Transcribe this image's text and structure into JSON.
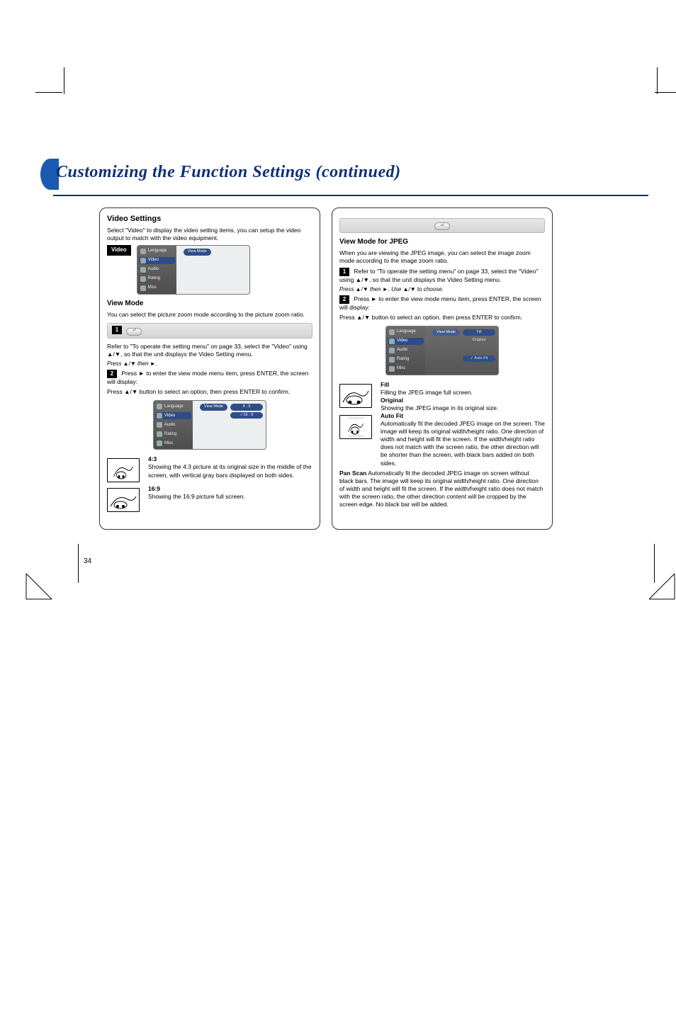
{
  "heading": "Customizing the Function Settings (continued)",
  "page_number": "34",
  "leftCol": {
    "title": "Video Settings",
    "desc": "Select \"Video\" to display the video setting items, you can setup the video output to match with the video equipment.",
    "badge": "Video",
    "viewModeTitle": "View Mode",
    "viewModeDesc": "You can select the picture zoom mode according to the picture zoom ratio.",
    "step1": "Refer to \"To operate the setting menu\" on page 33, select the \"Video\" using ▲/▼, so that the unit displays the Video Setting menu.",
    "step2a": "Press ► to enter the view mode menu item, press ENTER, the screen will display:",
    "step2b": "Press ▲/▼ button to select an option, then press ENTER to confirm.",
    "ratio43_title": "4:3",
    "ratio43_desc": "Showing the 4:3 picture at its original size in the middle of the screen, with vertical gray bars displayed on both sides.",
    "ratio169_title": "16:9",
    "ratio169_desc": "Showing the 16:9 picture full screen."
  },
  "rightCol": {
    "jpeg_title": "View Mode for JPEG",
    "jpeg_desc": "When you are viewing the JPEG image, you can select the image zoom mode according to the image zoom ratio.",
    "step1": "Refer to \"To operate the setting menu\" on page 33, select the \"Video\" using ▲/▼, so that the unit displays the Video Setting menu.",
    "step2a": "Press ► to enter the view mode menu item, press ENTER, the screen will display:",
    "step2b": "Press ▲/▼ button to select an option, then press ENTER to confirm.",
    "opt_fill": "Fill",
    "opt_fill_desc": "Filling the JPEG image full screen.",
    "opt_original": "Original",
    "opt_original_desc": "Showing the JPEG image in its original size.",
    "opt_autofit": "Auto Fit",
    "opt_autofit_desc": "Automatically fit the decoded JPEG image on the screen. The image will keep its original width/height ratio. One direction of width and height will fit the screen. If the width/height ratio does not match with the screen ratio, the other direction will be shorter than the screen, with black bars added on both sides.",
    "opt_panscan": "Pan Scan",
    "opt_panscan_desc": "Automatically fit the decoded JPEG image on screen without black bars. The image will keep its original width/height ratio. One direction of width and height will fit the screen. If the width/height ratio does not match with the screen ratio, the other direction content will be cropped by the screen edge. No black bar will be added.",
    "opt_autofit_label": "✓ Auto Fit"
  },
  "osd": {
    "sidebar": [
      "Language",
      "Video",
      "Audio",
      "Rating",
      "Misc"
    ],
    "viewMode": "View Mode",
    "opt43": "4 : 3",
    "opt169": "✓16 : 9",
    "optFill": "Fill",
    "optOriginal": "Original",
    "optAutoFit": "✓ Auto Fit"
  }
}
